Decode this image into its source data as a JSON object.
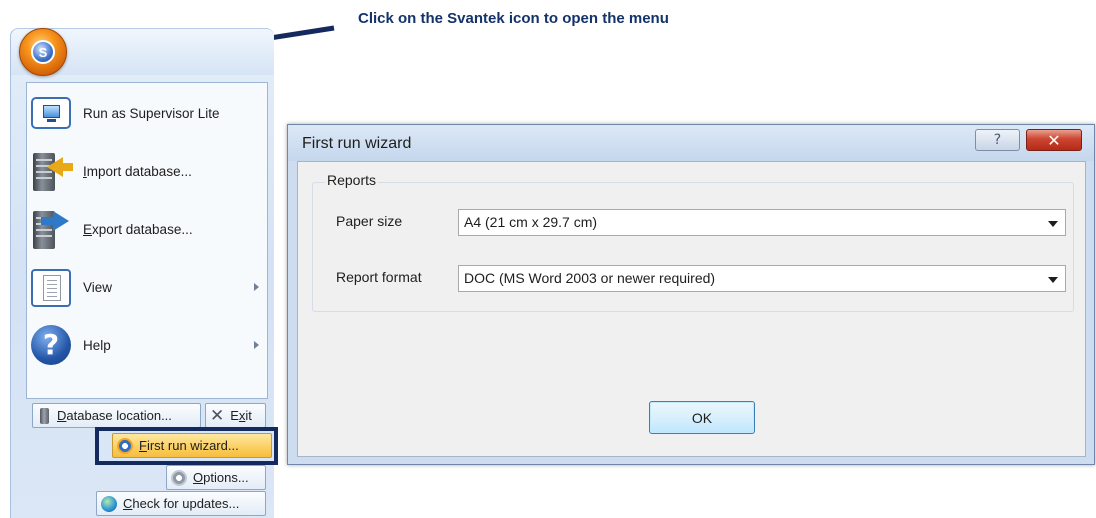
{
  "annotation": {
    "callout_text": "Click on the Svantek icon to open the menu"
  },
  "app_menu": {
    "svantek_button_glyph": "S",
    "items": [
      {
        "label": "Run as Supervisor Lite",
        "icon": "monitor-icon",
        "has_submenu": false
      },
      {
        "label": "Import database...",
        "icon": "server-import-icon",
        "has_submenu": false,
        "access_key": "I",
        "rest": "mport database..."
      },
      {
        "label": "Export database...",
        "icon": "server-export-icon",
        "has_submenu": false,
        "access_key": "E",
        "rest": "xport database..."
      },
      {
        "label": "View",
        "icon": "document-view-icon",
        "has_submenu": true
      },
      {
        "label": "Help",
        "icon": "help-icon",
        "has_submenu": true
      }
    ],
    "buttons": {
      "database_location": {
        "access_key": "D",
        "rest": "atabase location...",
        "icon": "database-icon"
      },
      "exit": {
        "pre": "E",
        "access_key": "x",
        "rest": "it",
        "icon": "close-icon"
      },
      "first_run_wizard": {
        "access_key": "F",
        "rest": "irst run wizard...",
        "icon": "gear-icon",
        "highlighted": true
      },
      "options": {
        "access_key": "O",
        "rest": "ptions...",
        "icon": "gear-icon"
      },
      "check_for_updates": {
        "access_key": "C",
        "rest": "heck for updates...",
        "icon": "globe-search-icon"
      }
    }
  },
  "dialog": {
    "title": "First run wizard",
    "help_glyph": "?",
    "close_glyph": "✕",
    "group_label": "Reports",
    "paper_size": {
      "label": "Paper size",
      "value": "A4 (21 cm x 29.7 cm)"
    },
    "report_format": {
      "label": "Report format",
      "value": "DOC (MS Word 2003 or newer required)"
    },
    "ok_label": "OK"
  },
  "colors": {
    "callout_text": "#13336a",
    "callout_arrow": "#14295e",
    "highlight_border": "#14295e",
    "close_button": "#cc4530",
    "svantek_orange": "#f7951d"
  }
}
